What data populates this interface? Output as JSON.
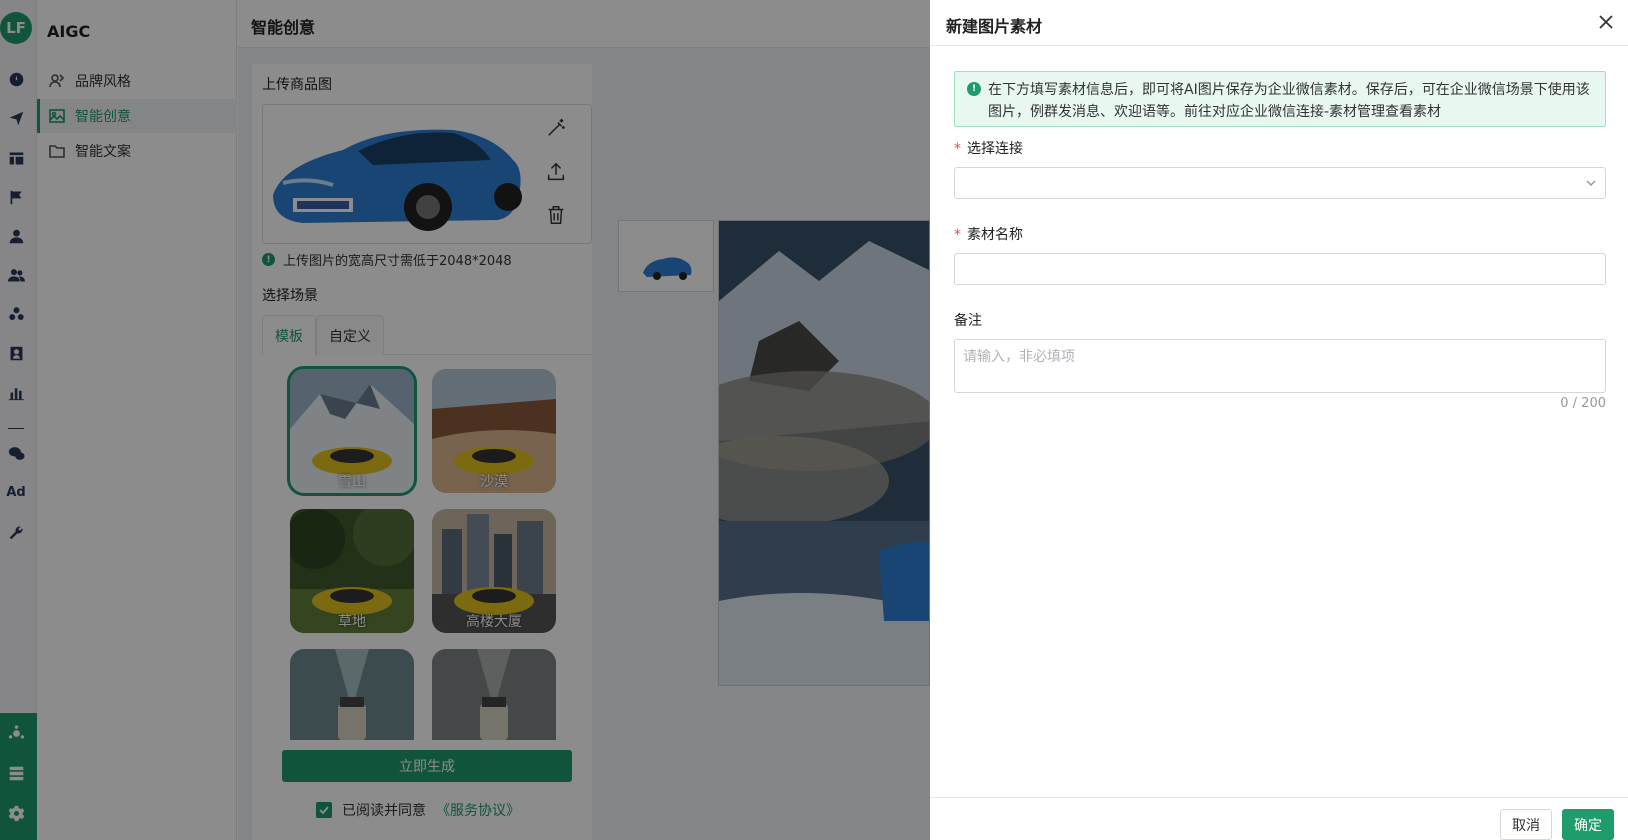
{
  "app": {
    "logo_text": "LF",
    "name": "AIGC"
  },
  "nav": {
    "items": [
      {
        "label": "品牌风格",
        "icon": "brand-icon"
      },
      {
        "label": "智能创意",
        "icon": "image-icon",
        "active": true
      },
      {
        "label": "智能文案",
        "icon": "folder-icon"
      }
    ]
  },
  "rail": {
    "ad_label": "Ad"
  },
  "page": {
    "title": "智能创意"
  },
  "upload": {
    "label": "上传商品图",
    "hint": "上传图片的宽高尺寸需低于2048*2048",
    "hint_icon": "!"
  },
  "scene": {
    "label": "选择场景",
    "tabs": [
      "模板",
      "自定义"
    ],
    "items": [
      "雪山",
      "沙漠",
      "草地",
      "高楼大厦"
    ]
  },
  "generate_label": "立即生成",
  "agree": {
    "text": "已阅读并同意",
    "link": "《服务协议》"
  },
  "drawer": {
    "title": "新建图片素材",
    "notice": "在下方填写素材信息后，即可将AI图片保存为企业微信素材。保存后，可在企业微信场景下使用该图片，例群发消息、欢迎语等。前往对应企业微信连接-素材管理查看素材",
    "notice_icon": "!",
    "fields": {
      "connection_label": "选择连接",
      "name_label": "素材名称",
      "remark_label": "备注",
      "remark_placeholder": "请输入，非必填项",
      "remark_count": "0 / 200",
      "required_mark": "*"
    },
    "cancel_label": "取消",
    "ok_label": "确定"
  },
  "colors": {
    "accent": "#1e9c6c",
    "required": "#e34d59",
    "notice_bg": "#e8f8f0"
  }
}
